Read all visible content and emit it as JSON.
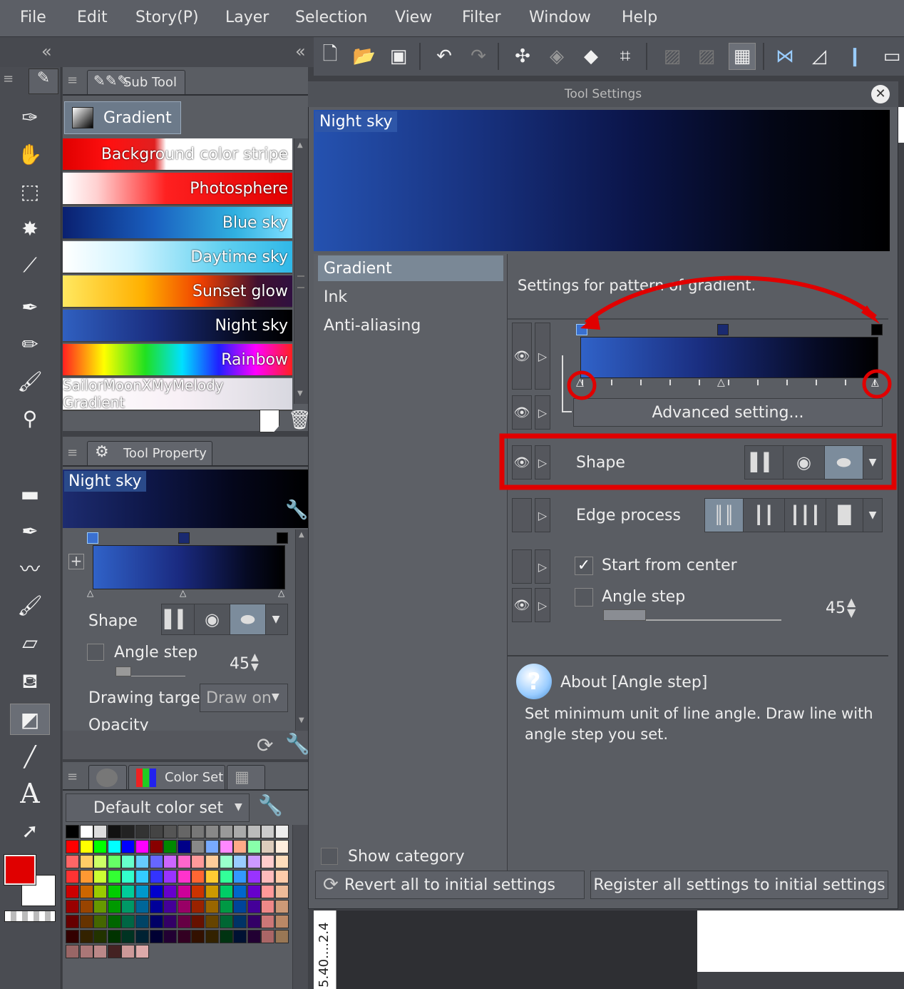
{
  "menu": [
    "File",
    "Edit",
    "Story(P)",
    "Layer",
    "Selection",
    "View",
    "Filter",
    "Window",
    "Help"
  ],
  "subtool": {
    "tab": "Sub Tool",
    "group": "Gradient",
    "items": [
      {
        "label": "Background color stripe",
        "css": "linear-gradient(90deg,#e00000 0%,#ff1010 20%,#e02020 40%,#ffffff 45%,#ffffff 100%)"
      },
      {
        "label": "Photosphere",
        "css": "linear-gradient(90deg,#ffffff 0%,#ffd0d0 15%,#ff2020 45%,#e00000 100%)"
      },
      {
        "label": "Blue sky",
        "css": "linear-gradient(90deg,#0a2070 0%,#1a60c0 40%,#30b0e0 75%,#80e0ff 100%)"
      },
      {
        "label": "Daytime sky",
        "css": "linear-gradient(90deg,#ffffff 0%,#d0f4ff 30%,#60d0f0 70%,#30b8e8 100%)"
      },
      {
        "label": "Sunset glow",
        "css": "linear-gradient(90deg,#ffe860 0%,#ffb000 35%,#f04000 60%,#401030 85%,#301040 100%)"
      },
      {
        "label": "Night sky",
        "css": "linear-gradient(90deg,#3060c0 0%,#1a2e80 40%,#05081a 80%,#000 100%)"
      },
      {
        "label": "Rainbow",
        "css": "linear-gradient(90deg,#ff2020 0%,#ffff00 18%,#20e020 36%,#00e0ff 52%,#2020ff 68%,#ff00ff 84%,#ff2020 100%)"
      },
      {
        "label": "SailorMoonXMyMelody Gradient",
        "css": "linear-gradient(90deg,#ffffff 0%,#f8f0f6 50%,#d8d8e0 100%)"
      }
    ]
  },
  "toolprop": {
    "tab": "Tool Property",
    "preset": "Night sky",
    "shape_label": "Shape",
    "angle_label": "Angle step",
    "angle_value": "45",
    "target_label": "Drawing target",
    "target_value": "Draw on",
    "opacity_label": "Opacity"
  },
  "colorset": {
    "tab": "Color Set",
    "dropdown": "Default color set"
  },
  "ts": {
    "title": "Tool Settings",
    "preview": "Night sky",
    "categories": [
      "Gradient",
      "Ink",
      "Anti-aliasing"
    ],
    "heading": "Settings for pattern of gradient.",
    "advanced": "Advanced setting...",
    "shape_label": "Shape",
    "edge_label": "Edge process",
    "start_center": "Start from center",
    "angle_label": "Angle step",
    "angle_value": "45",
    "about_title": "About [Angle step]",
    "about_text": "Set minimum unit of line angle. Draw line with angle step you set.",
    "show_category": "Show category",
    "revert": "Revert all to initial settings",
    "register": "Register all settings to initial settings"
  },
  "ruler": "5.40....2.4",
  "colors": {
    "accent": "#e00000",
    "selected": "#7c8c9c",
    "main": "#e00000",
    "sub": "#ffffff"
  }
}
